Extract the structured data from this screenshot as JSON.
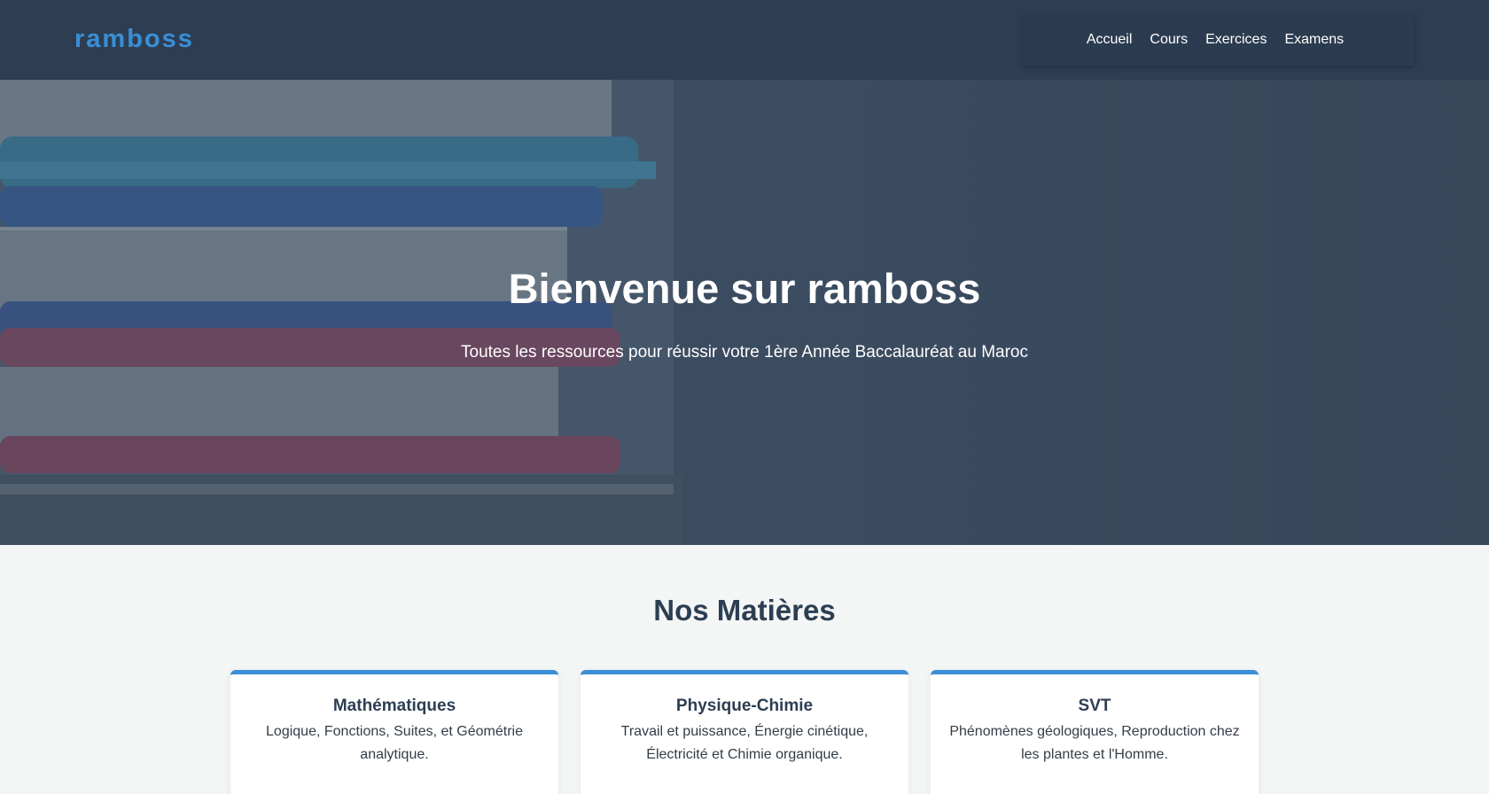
{
  "header": {
    "logo": "ramboss",
    "nav": [
      "Accueil",
      "Cours",
      "Exercices",
      "Examens"
    ]
  },
  "hero": {
    "title": "Bienvenue sur ramboss",
    "subtitle": "Toutes les ressources pour réussir votre 1ère Année Baccalauréat au Maroc",
    "background_image": "stack-of-books-photo"
  },
  "subjects": {
    "title": "Nos Matières",
    "cards": [
      {
        "title": "Mathématiques",
        "description": "Logique, Fonctions, Suites, et Géométrie analytique."
      },
      {
        "title": "Physique-Chimie",
        "description": "Travail et puissance, Énergie cinétique, Électricité et Chimie organique."
      },
      {
        "title": "SVT",
        "description": "Phénomènes géologiques, Reproduction chez les plantes et l'Homme."
      }
    ]
  },
  "colors": {
    "header_bg": "#2d3e52",
    "accent": "#3a8fd6",
    "page_bg": "#f4f6f5",
    "heading_text": "#2c3e52"
  }
}
